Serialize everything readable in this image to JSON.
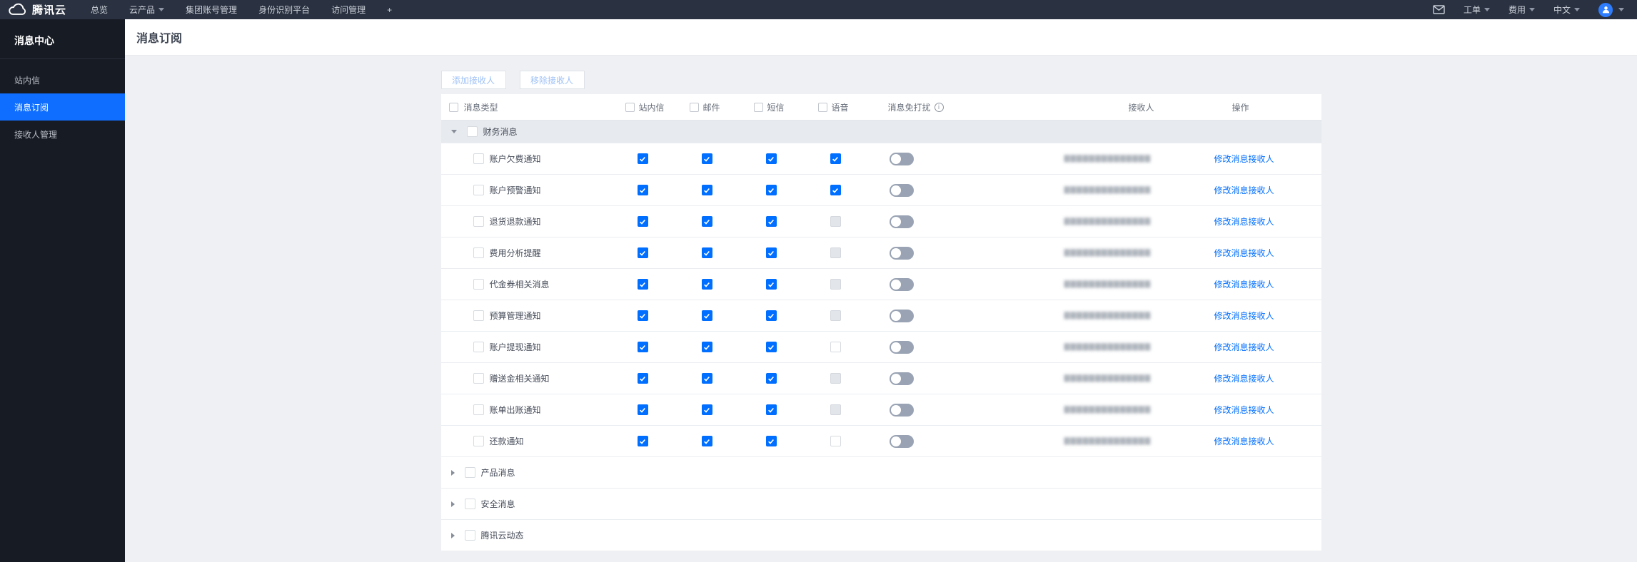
{
  "colors": {
    "accent_blue": "#006eff",
    "sidebar_active_blue": "#0f6eff",
    "topnav_bg": "#2a3140",
    "sidebar_bg": "#171b23",
    "content_bg": "#eef0f3",
    "group_row_bg": "#e7eaee",
    "toggle_off": "#99a3b3"
  },
  "topnav": {
    "brand": "腾讯云",
    "items": [
      {
        "label": "总览",
        "dropdown": false
      },
      {
        "label": "云产品",
        "dropdown": true
      },
      {
        "label": "集团账号管理",
        "dropdown": false
      },
      {
        "label": "身份识别平台",
        "dropdown": false
      },
      {
        "label": "访问管理",
        "dropdown": false
      },
      {
        "label": "+",
        "dropdown": false
      }
    ],
    "right_items": [
      {
        "label": "工单",
        "dropdown": true
      },
      {
        "label": "费用",
        "dropdown": true
      },
      {
        "label": "中文",
        "dropdown": true
      }
    ]
  },
  "sidebar": {
    "title": "消息中心",
    "items": [
      {
        "label": "站内信",
        "active": false
      },
      {
        "label": "消息订阅",
        "active": true
      },
      {
        "label": "接收人管理",
        "active": false
      }
    ]
  },
  "page": {
    "title": "消息订阅"
  },
  "toolbar": {
    "add_label": "添加接收人",
    "remove_label": "移除接收人"
  },
  "table": {
    "headers": {
      "type": "消息类型",
      "channels": [
        "站内信",
        "邮件",
        "短信",
        "语音"
      ],
      "dnd": "消息免打扰",
      "receiver": "接收人",
      "action": "操作"
    },
    "receiver_masked": "▇▇▇▇▇▇▇▇▇▇▇▇▇▇",
    "action_label": "修改消息接收人",
    "groups": [
      {
        "label": "财务消息",
        "expanded": true,
        "rows": [
          {
            "label": "账户欠费通知",
            "channels": [
              "checked",
              "checked",
              "checked",
              "checked"
            ],
            "dnd": false
          },
          {
            "label": "账户预警通知",
            "channels": [
              "checked",
              "checked",
              "checked",
              "checked"
            ],
            "dnd": false
          },
          {
            "label": "退货退款通知",
            "channels": [
              "checked",
              "checked",
              "checked",
              "disabled"
            ],
            "dnd": false
          },
          {
            "label": "费用分析提醒",
            "channels": [
              "checked",
              "checked",
              "checked",
              "disabled"
            ],
            "dnd": false
          },
          {
            "label": "代金券相关消息",
            "channels": [
              "checked",
              "checked",
              "checked",
              "disabled"
            ],
            "dnd": false
          },
          {
            "label": "预算管理通知",
            "channels": [
              "checked",
              "checked",
              "checked",
              "disabled"
            ],
            "dnd": false
          },
          {
            "label": "账户提现通知",
            "channels": [
              "checked",
              "checked",
              "checked",
              "unchecked"
            ],
            "dnd": false
          },
          {
            "label": "赠送金相关通知",
            "channels": [
              "checked",
              "checked",
              "checked",
              "disabled"
            ],
            "dnd": false
          },
          {
            "label": "账单出账通知",
            "channels": [
              "checked",
              "checked",
              "checked",
              "disabled"
            ],
            "dnd": false
          },
          {
            "label": "还款通知",
            "channels": [
              "checked",
              "checked",
              "checked",
              "unchecked"
            ],
            "dnd": false
          }
        ]
      },
      {
        "label": "产品消息",
        "expanded": false,
        "rows": []
      },
      {
        "label": "安全消息",
        "expanded": false,
        "rows": []
      },
      {
        "label": "腾讯云动态",
        "expanded": false,
        "rows": []
      }
    ]
  }
}
